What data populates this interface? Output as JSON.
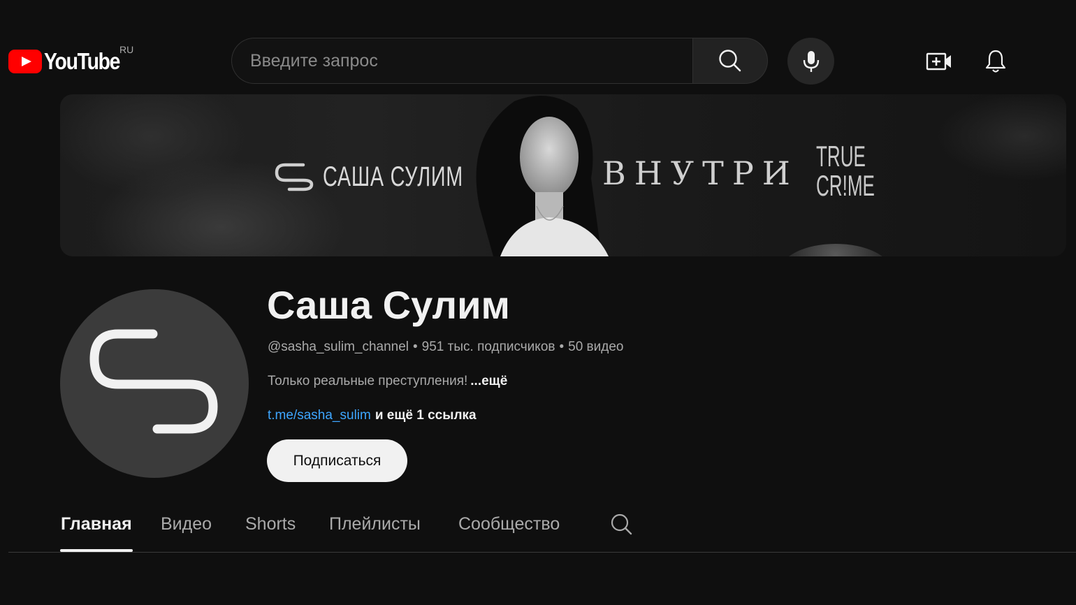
{
  "header": {
    "logo_text": "YouTube",
    "country_code": "RU",
    "search_placeholder": "Введите запрос",
    "create_icon": "video-plus-icon",
    "notifications_icon": "bell-icon",
    "voice_icon": "mic-icon"
  },
  "banner": {
    "brand_text": "САША СУЛИМ",
    "series_text": "ВНУТРИ",
    "tagline_line1": "TRUE",
    "tagline_line2": "CR!ME"
  },
  "channel": {
    "name": "Саша Сулим",
    "handle": "@sasha_sulim_channel",
    "subscribers": "951 тыс. подписчиков",
    "videos": "50 видео",
    "description": "Только реальные преступления!",
    "description_more": "...ещё",
    "link": "t.me/sasha_sulim",
    "more_links": "и ещё 1 ссылка",
    "subscribe_label": "Подписаться",
    "meta_separator": "•"
  },
  "tabs": {
    "items": [
      {
        "label": "Главная",
        "active": true
      },
      {
        "label": "Видео",
        "active": false
      },
      {
        "label": "Shorts",
        "active": false
      },
      {
        "label": "Плейлисты",
        "active": false
      },
      {
        "label": "Сообщество",
        "active": false
      }
    ],
    "search_icon": "search-icon"
  },
  "colors": {
    "background": "#0f0f0f",
    "brand_red": "#ff0000",
    "link_blue": "#3ea6ff",
    "subscribe_bg": "#f1f1f1"
  }
}
